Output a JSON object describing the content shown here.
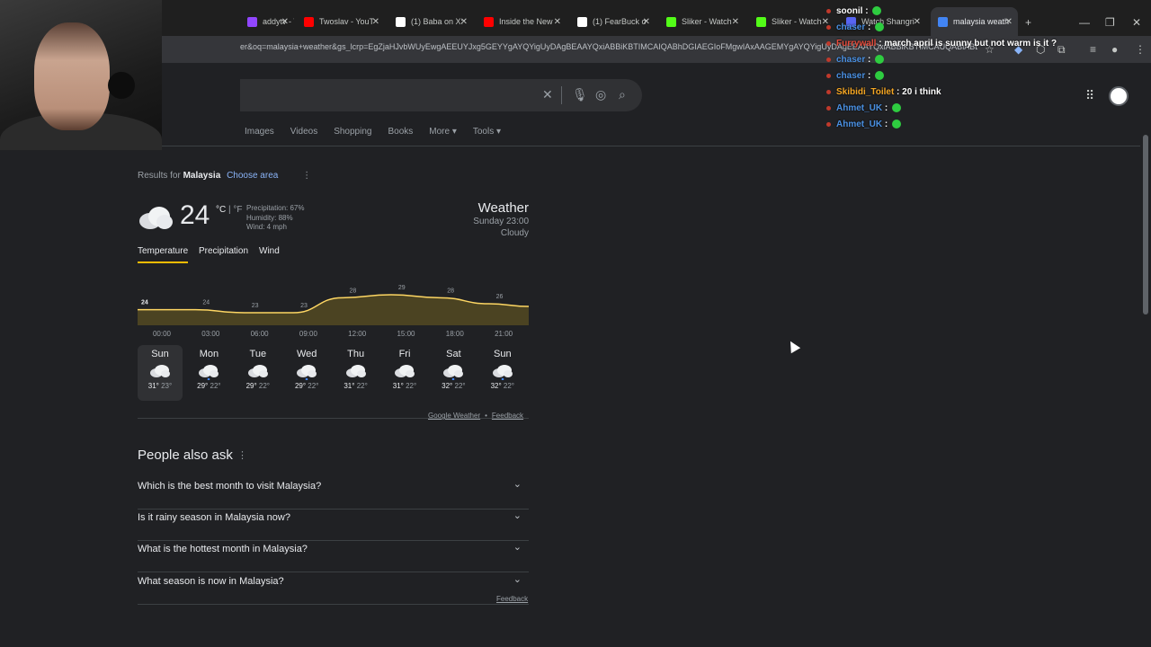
{
  "browser": {
    "tabs": [
      {
        "label": "addytv - T",
        "icon_color": "#9146ff"
      },
      {
        "label": "Twoslav - YouT",
        "icon_color": "#ff0000"
      },
      {
        "label": "(1) Baba on X:",
        "icon_color": "#ffffff"
      },
      {
        "label": "Inside the New",
        "icon_color": "#ff0000"
      },
      {
        "label": "(1) FearBuck o",
        "icon_color": "#ffffff"
      },
      {
        "label": "Sliker - Watch",
        "icon_color": "#53fc18"
      },
      {
        "label": "Sliker - Watch",
        "icon_color": "#53fc18"
      },
      {
        "label": "Watch Shangri",
        "icon_color": "#5865f2"
      },
      {
        "label": "malaysia weath",
        "icon_color": "#4285f4"
      }
    ],
    "url": "er&oq=malaysia+weather&gs_lcrp=EgZjaHJvbWUyEwgAEEUYJxg5GEYYgAYQYigUyDAgBEAAYQxiABBiKBTIMCAIQABhDGIAEGIoFMgwIAxAAGEMYgAYQYigUyDAgEEAAYQxiABBiKBTIMCAUQABiABDI..."
  },
  "search": {
    "query": "",
    "nav_tabs": [
      "Images",
      "Videos",
      "Shopping",
      "Books",
      "More",
      "Tools"
    ]
  },
  "weather": {
    "results_for_prefix": "Results for",
    "location": "Malaysia",
    "choose_area": "Choose area",
    "temp": "24",
    "unit_c": "°C",
    "unit_sep": " | ",
    "unit_f": "°F",
    "precipitation": "Precipitation: 67%",
    "humidity": "Humidity: 88%",
    "wind": "Wind: 4 mph",
    "title": "Weather",
    "datetime": "Sunday 23:00",
    "condition": "Cloudy",
    "tabs": [
      "Temperature",
      "Precipitation",
      "Wind"
    ],
    "source": "Google Weather",
    "feedback": "Feedback",
    "days": [
      {
        "name": "Sun",
        "hi": "31°",
        "lo": "23°",
        "rain": false
      },
      {
        "name": "Mon",
        "hi": "29°",
        "lo": "22°",
        "rain": true
      },
      {
        "name": "Tue",
        "hi": "29°",
        "lo": "22°",
        "rain": false
      },
      {
        "name": "Wed",
        "hi": "29°",
        "lo": "22°",
        "rain": true
      },
      {
        "name": "Thu",
        "hi": "31°",
        "lo": "22°",
        "rain": false
      },
      {
        "name": "Fri",
        "hi": "31°",
        "lo": "22°",
        "rain": false
      },
      {
        "name": "Sat",
        "hi": "32°",
        "lo": "22°",
        "rain": true
      },
      {
        "name": "Sun",
        "hi": "32°",
        "lo": "22°",
        "rain": true
      }
    ]
  },
  "chart_data": {
    "type": "area",
    "x": [
      "00:00",
      "03:00",
      "06:00",
      "09:00",
      "12:00",
      "15:00",
      "18:00",
      "21:00"
    ],
    "point_labels": [
      "24",
      "24",
      "23",
      "23",
      "28",
      "29",
      "28",
      "26"
    ],
    "values": [
      24,
      24,
      23,
      23,
      28,
      29,
      28,
      26
    ],
    "color": "#fdd663"
  },
  "paa": {
    "title": "People also ask",
    "questions": [
      "Which is the best month to visit Malaysia?",
      "Is it rainy season in Malaysia now?",
      "What is the hottest month in Malaysia?",
      "What season is now in Malaysia?"
    ],
    "feedback": "Feedback"
  },
  "chat": [
    {
      "user": "soonil",
      "color": "#ffffff",
      "msg": ""
    },
    {
      "user": "chaser",
      "color": "#4a90e2",
      "msg": ""
    },
    {
      "user": "Furrywall",
      "color": "#e74c3c",
      "msg": "march april is sunny but not warm is it ?"
    },
    {
      "user": "chaser",
      "color": "#4a90e2",
      "msg": ""
    },
    {
      "user": "chaser",
      "color": "#4a90e2",
      "msg": ""
    },
    {
      "user": "Skibidi_Toilet",
      "color": "#f5a623",
      "msg": "20 i think"
    },
    {
      "user": "Ahmet_UK",
      "color": "#4a90e2",
      "msg": ""
    },
    {
      "user": "Ahmet_UK",
      "color": "#4a90e2",
      "msg": ""
    }
  ]
}
